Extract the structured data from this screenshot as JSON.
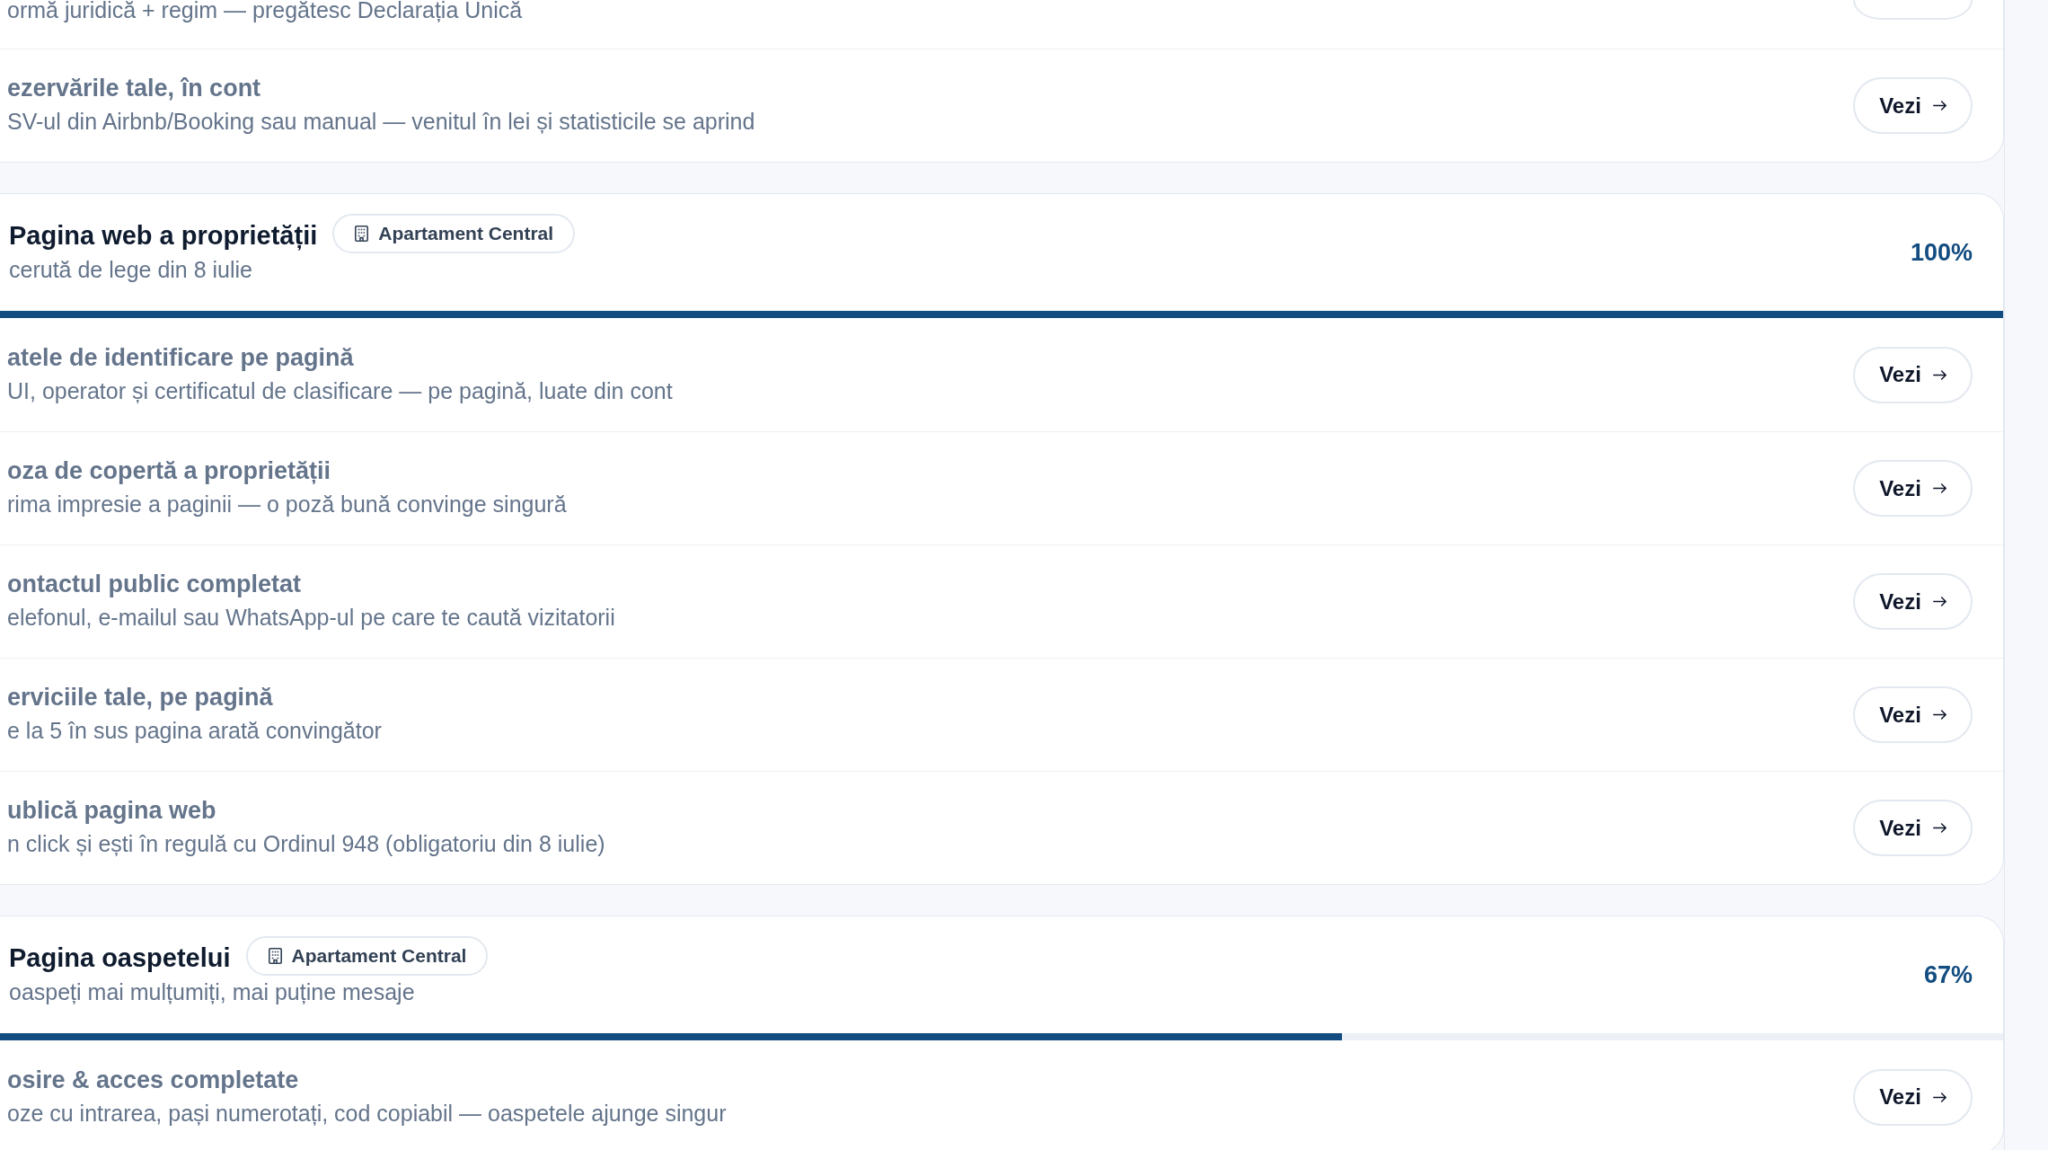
{
  "sections": [
    {
      "tasks": [
        {
          "kind": "clipped",
          "description": "ormă juridică + regim — pregătesc Declarația Unică"
        },
        {
          "kind": "task",
          "title": "ezervările tale, în cont",
          "description": "SV-ul din Airbnb/Booking sau manual — venitul în lei și statisticile se aprind",
          "button": "Vezi"
        }
      ]
    },
    {
      "title": "Pagina web a proprietății",
      "badge": "Apartament Central",
      "subtitle": "cerută de lege din 8 iulie",
      "percent": "100%",
      "level": 1,
      "tasks": [
        {
          "kind": "task",
          "title": "atele de identificare pe pagină",
          "description": "UI, operator și certificatul de clasificare — pe pagină, luate din cont",
          "button": "Vezi"
        },
        {
          "kind": "task",
          "title": "oza de copertă a proprietății",
          "description": "rima impresie a paginii — o poză bună convinge singură",
          "button": "Vezi"
        },
        {
          "kind": "task",
          "title": "ontactul public completat",
          "description": "elefonul, e-mailul sau WhatsApp-ul pe care te caută vizitatorii",
          "button": "Vezi"
        },
        {
          "kind": "task",
          "title": "erviciile tale, pe pagină",
          "description": "e la 5 în sus pagina arată convingător",
          "button": "Vezi"
        },
        {
          "kind": "task",
          "title": "ublică pagina web",
          "description": "n click și ești în regulă cu Ordinul 948 (obligatoriu din 8 iulie)",
          "button": "Vezi"
        }
      ]
    },
    {
      "title": "Pagina oaspetelui",
      "badge": "Apartament Central",
      "subtitle": "oaspeți mai mulțumiți, mai puține mesaje",
      "percent": "67%",
      "level": 0.67,
      "tasks": [
        {
          "kind": "task",
          "title": "osire & acces completate",
          "description": "oze cu intrarea, pași numerotați, cod copiabil — oaspetele ajunge singur",
          "button": "Vezi"
        }
      ]
    }
  ]
}
